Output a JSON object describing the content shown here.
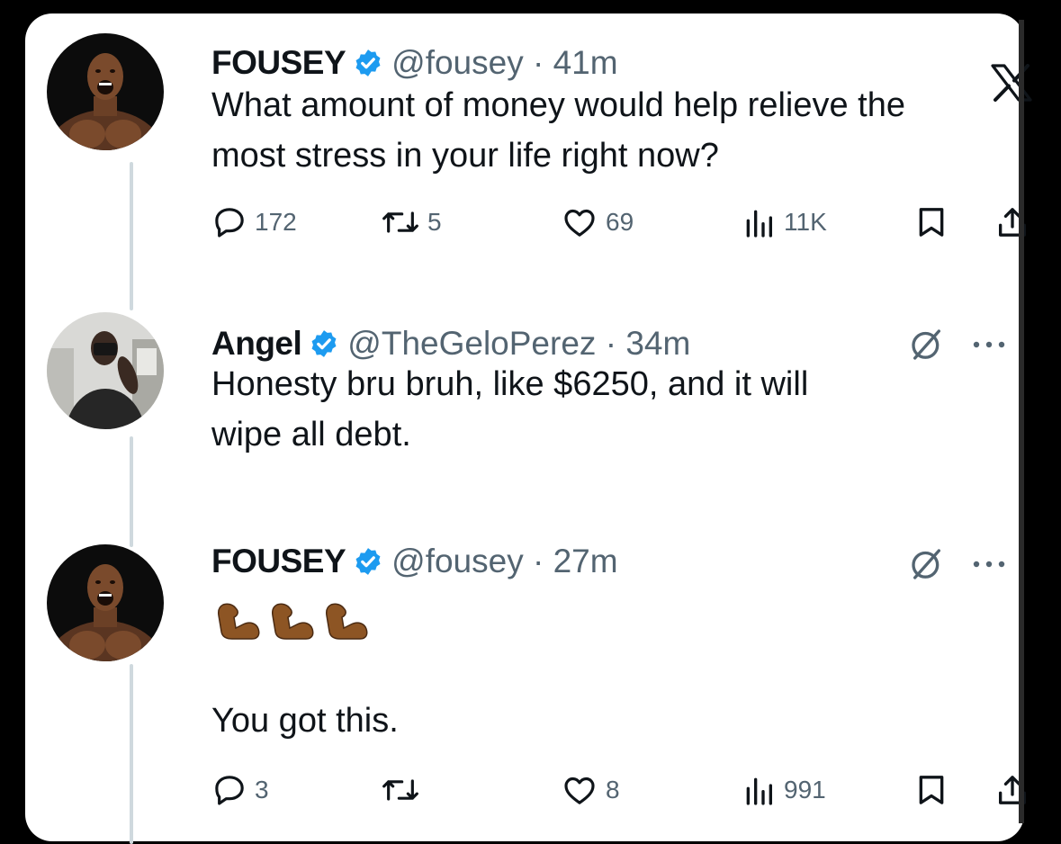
{
  "tweets": [
    {
      "display_name": "FOUSEY",
      "handle": "@fousey",
      "time": "41m",
      "text_lines": [
        "What amount of money would help relieve the",
        "most stress in your life right now?"
      ],
      "replies": "172",
      "reposts": "5",
      "likes": "69",
      "views": "11K"
    },
    {
      "display_name": "Angel",
      "handle": "@TheGeloPerez",
      "time": "34m",
      "text_lines": [
        "Honesty bru bruh, like $6250, and it will",
        "wipe all debt."
      ]
    },
    {
      "display_name": "FOUSEY",
      "handle": "@fousey",
      "time": "27m",
      "emoji_name": "flexed-biceps-medium-dark-skin-tone",
      "emoji_count": 3,
      "text": "You got this.",
      "replies": "3",
      "reposts": "",
      "likes": "8",
      "views": "991"
    }
  ],
  "colors": {
    "verified_badge": "#1d9bf0",
    "secondary_text": "#536471",
    "thread_line": "#cfd9de",
    "page_background": "#000000",
    "card_background": "#ffffff"
  },
  "icons": [
    "x-logo",
    "verified-badge",
    "reply-icon",
    "repost-icon",
    "like-icon",
    "views-icon",
    "bookmark-icon",
    "share-icon",
    "grok-icon",
    "more-icon"
  ]
}
